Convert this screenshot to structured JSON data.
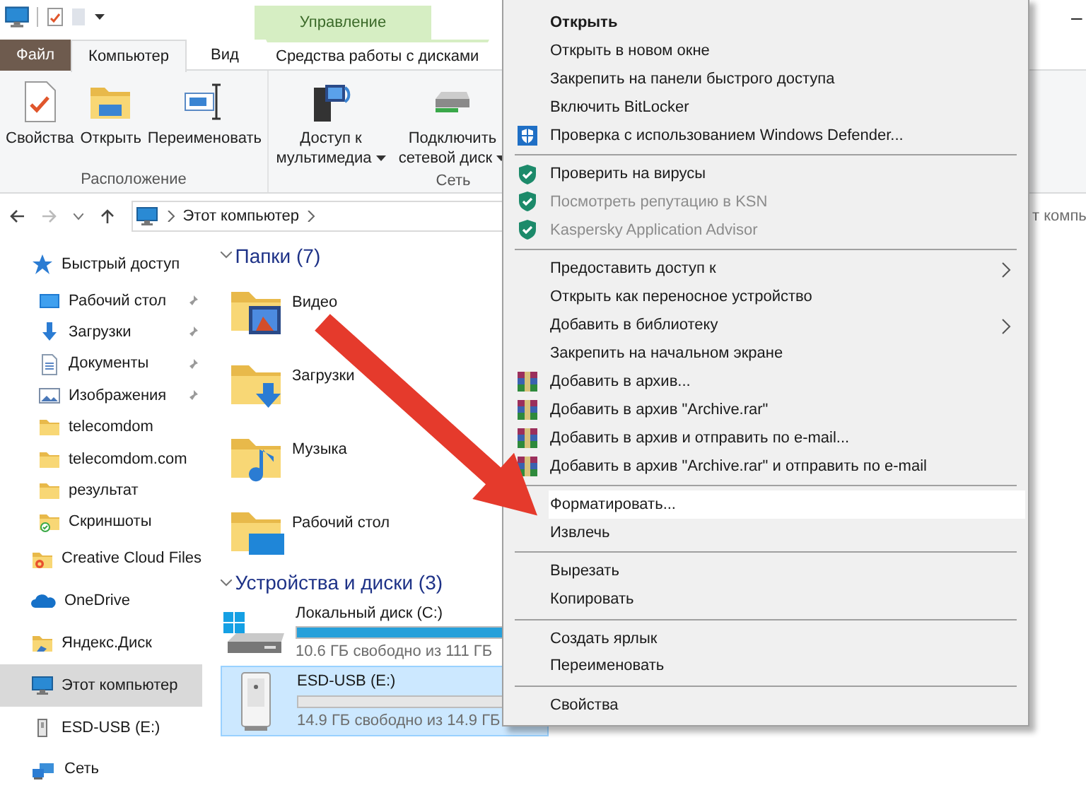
{
  "title_bar": {
    "contextual_group": "Управление",
    "minimize_glyph": "–"
  },
  "ribbon_tabs": [
    {
      "label": "Файл",
      "kind": "file",
      "selected": false
    },
    {
      "label": "Компьютер",
      "kind": "normal",
      "selected": true
    },
    {
      "label": "Вид",
      "kind": "normal",
      "selected": false
    },
    {
      "label": "Средства работы с дисками",
      "kind": "contextual",
      "selected": false
    }
  ],
  "ribbon_groups": [
    {
      "label": "Расположение",
      "buttons": [
        {
          "label": "Свойства",
          "kind": "properties",
          "dropdown": false
        },
        {
          "label": "Открыть",
          "kind": "open",
          "dropdown": false
        },
        {
          "label": "Переименовать",
          "kind": "rename",
          "dropdown": false
        }
      ]
    },
    {
      "label": "Сеть",
      "buttons": [
        {
          "label": "Доступ к мультимедиа",
          "kind": "media",
          "dropdown": true
        },
        {
          "label": "Подключить сетевой диск",
          "kind": "network-drive",
          "dropdown": true
        }
      ]
    }
  ],
  "address_bar": {
    "path": [
      "Этот компьютер"
    ]
  },
  "search": {
    "visible_text": "т компь"
  },
  "sidebar": [
    {
      "label": "Быстрый доступ",
      "kind": "quick",
      "selected": false,
      "children": [
        {
          "label": "Рабочий стол",
          "kind": "desktop",
          "pinned": true,
          "selected": false
        },
        {
          "label": "Загрузки",
          "kind": "downloads",
          "pinned": true,
          "selected": false
        },
        {
          "label": "Документы",
          "kind": "documents",
          "pinned": true,
          "selected": false
        },
        {
          "label": "Изображения",
          "kind": "pictures",
          "pinned": true,
          "selected": false
        },
        {
          "label": "telecomdom",
          "kind": "folder",
          "pinned": false,
          "selected": false
        },
        {
          "label": "telecomdom.com",
          "kind": "folder",
          "pinned": false,
          "selected": false
        },
        {
          "label": "результат",
          "kind": "folder",
          "pinned": false,
          "selected": false
        },
        {
          "label": "Скриншоты",
          "kind": "screenshots",
          "pinned": false,
          "selected": false
        }
      ]
    },
    {
      "label": "Creative Cloud Files",
      "kind": "cc",
      "selected": false
    },
    {
      "label": "OneDrive",
      "kind": "onedrive",
      "selected": false
    },
    {
      "label": "Яндекс.Диск",
      "kind": "yandex",
      "selected": false
    },
    {
      "label": "Этот компьютер",
      "kind": "pc",
      "selected": true
    },
    {
      "label": "ESD-USB (E:)",
      "kind": "usb",
      "selected": false
    },
    {
      "label": "Сеть",
      "kind": "network",
      "selected": false
    }
  ],
  "sections": [
    {
      "title": "Папки (7)",
      "kind": "folders",
      "expanded": true,
      "items": [
        {
          "label": "Видео",
          "kind": "video"
        },
        {
          "label": "Загрузки",
          "kind": "downloads"
        },
        {
          "label": "Музыка",
          "kind": "music"
        },
        {
          "label": "Рабочий стол",
          "kind": "desktop"
        }
      ]
    },
    {
      "title": "Устройства и диски (3)",
      "kind": "drives",
      "expanded": true,
      "items": [
        {
          "label": "Локальный диск (C:)",
          "kind": "system",
          "free": "10.6 ГБ свободно из 111 ГБ",
          "level": 0.9,
          "selected": false
        },
        {
          "label": "ESD-USB (E:)",
          "kind": "usb",
          "free": "14.9 ГБ свободно из 14.9 ГБ",
          "level": 0,
          "selected": true
        }
      ]
    }
  ],
  "context_menu": [
    {
      "kind": "item",
      "label": "Открыть",
      "bold": true,
      "disabled": false,
      "submenu": false,
      "selected": false
    },
    {
      "kind": "item",
      "label": "Открыть в новом окне",
      "bold": false,
      "disabled": false,
      "submenu": false,
      "selected": false
    },
    {
      "kind": "item",
      "label": "Закрепить на панели быстрого доступа",
      "bold": false,
      "disabled": false,
      "submenu": false,
      "selected": false
    },
    {
      "kind": "item",
      "label": "Включить BitLocker",
      "bold": false,
      "disabled": false,
      "submenu": false,
      "selected": false
    },
    {
      "kind": "defender-item",
      "label": "Проверка с использованием Windows Defender...",
      "bold": false,
      "disabled": false,
      "submenu": false,
      "selected": false
    },
    {
      "kind": "separator"
    },
    {
      "kind": "antivirus-item",
      "label": "Проверить на вирусы",
      "bold": false,
      "disabled": false,
      "submenu": false,
      "selected": false
    },
    {
      "kind": "antivirus-item",
      "label": "Посмотреть репутацию в KSN",
      "bold": false,
      "disabled": true,
      "submenu": false,
      "selected": false
    },
    {
      "kind": "antivirus-item",
      "label": "Kaspersky Application Advisor",
      "bold": false,
      "disabled": true,
      "submenu": false,
      "selected": false
    },
    {
      "kind": "separator"
    },
    {
      "kind": "item",
      "label": "Предоставить доступ к",
      "bold": false,
      "disabled": false,
      "submenu": true,
      "selected": false
    },
    {
      "kind": "item",
      "label": "Открыть как переносное устройство",
      "bold": false,
      "disabled": false,
      "submenu": false,
      "selected": false
    },
    {
      "kind": "item",
      "label": "Добавить в библиотеку",
      "bold": false,
      "disabled": false,
      "submenu": true,
      "selected": false
    },
    {
      "kind": "item",
      "label": "Закрепить на начальном экране",
      "bold": false,
      "disabled": false,
      "submenu": false,
      "selected": false
    },
    {
      "kind": "archive-item",
      "label": "Добавить в архив...",
      "bold": false,
      "disabled": false,
      "submenu": false,
      "selected": false
    },
    {
      "kind": "archive-item",
      "label": "Добавить в архив \"Archive.rar\"",
      "bold": false,
      "disabled": false,
      "submenu": false,
      "selected": false
    },
    {
      "kind": "archive-item",
      "label": "Добавить в архив и отправить по e-mail...",
      "bold": false,
      "disabled": false,
      "submenu": false,
      "selected": false
    },
    {
      "kind": "archive-item",
      "label": "Добавить в архив \"Archive.rar\" и отправить по e-mail",
      "bold": false,
      "disabled": false,
      "submenu": false,
      "selected": false
    },
    {
      "kind": "separator"
    },
    {
      "kind": "item",
      "label": "Форматировать...",
      "bold": false,
      "disabled": false,
      "submenu": false,
      "selected": true
    },
    {
      "kind": "item",
      "label": "Извлечь",
      "bold": false,
      "disabled": false,
      "submenu": false,
      "selected": false
    },
    {
      "kind": "separator"
    },
    {
      "kind": "item",
      "label": "Вырезать",
      "bold": false,
      "disabled": false,
      "submenu": false,
      "selected": false
    },
    {
      "kind": "item",
      "label": "Копировать",
      "bold": false,
      "disabled": false,
      "submenu": false,
      "selected": false
    },
    {
      "kind": "separator"
    },
    {
      "kind": "item",
      "label": "Создать ярлык",
      "bold": false,
      "disabled": false,
      "submenu": false,
      "selected": false
    },
    {
      "kind": "item",
      "label": "Переименовать",
      "bold": false,
      "disabled": false,
      "submenu": false,
      "selected": false
    },
    {
      "kind": "separator"
    },
    {
      "kind": "item",
      "label": "Свойства",
      "bold": false,
      "disabled": false,
      "submenu": false,
      "selected": false
    }
  ],
  "annotation": {
    "kind": "arrow"
  }
}
